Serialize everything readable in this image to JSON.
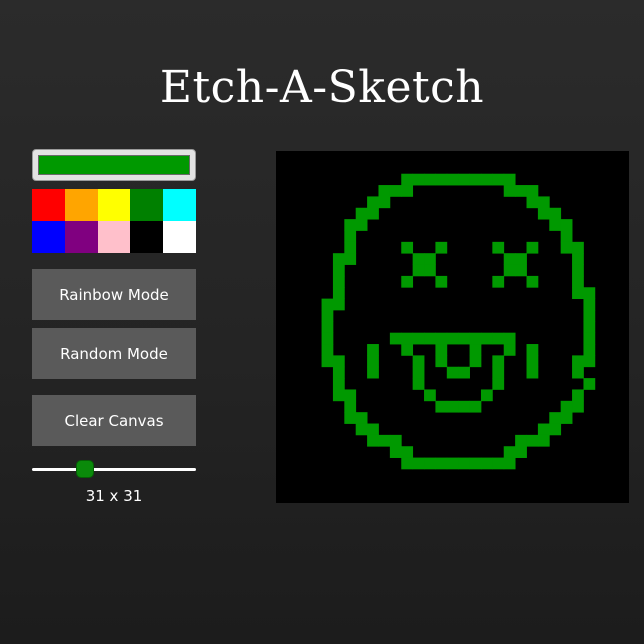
{
  "app": {
    "title": "Etch-A-Sketch"
  },
  "controls": {
    "current_color": "#009900",
    "palette": [
      {
        "name": "red",
        "color": "#ff0000"
      },
      {
        "name": "orange",
        "color": "#ffa500"
      },
      {
        "name": "yellow",
        "color": "#ffff00"
      },
      {
        "name": "green",
        "color": "#008000"
      },
      {
        "name": "cyan",
        "color": "#00ffff"
      },
      {
        "name": "blue",
        "color": "#0000ff"
      },
      {
        "name": "purple",
        "color": "#800080"
      },
      {
        "name": "pink",
        "color": "#ffc0cb"
      },
      {
        "name": "black",
        "color": "#000000"
      },
      {
        "name": "white",
        "color": "#ffffff"
      }
    ],
    "rainbow_label": "Rainbow Mode",
    "random_label": "Random Mode",
    "clear_label": "Clear Canvas",
    "grid_size_min": 1,
    "grid_size_max": 100,
    "grid_size": 31,
    "size_label": "31 x 31"
  },
  "canvas": {
    "background": "#000000",
    "ink_color": "#009900",
    "rows": [
      "...............................",
      "...............................",
      "...........##########..........",
      ".........###........###........",
      "........##............##.......",
      ".......##..............##......",
      "......##................##.....",
      "......#..................#.....",
      "......#....#..#....#..#..##....",
      ".....##.....##......##....#....",
      ".....#......##......##....#....",
      ".....#.....#..#....#..#...#....",
      ".....#....................##...",
      "....##.....................#...",
      "....#......................#...",
      "....#......................#...",
      "....#.....###########......#...",
      "....#...#..#..#..#..#.#....#...",
      "....##..#...#.#..#.#..#...##...",
      ".....#..#...#..##..#..#...#....",
      ".....#......#......#.......#....",
      ".....##......#....#.......#....",
      "......#.......####.......##....",
      "......##................##.....",
      ".......##..............##......",
      "........###..........###.......",
      "..........##........##.........",
      "...........##########..........",
      "...............................",
      "...............................",
      "..............................."
    ]
  }
}
